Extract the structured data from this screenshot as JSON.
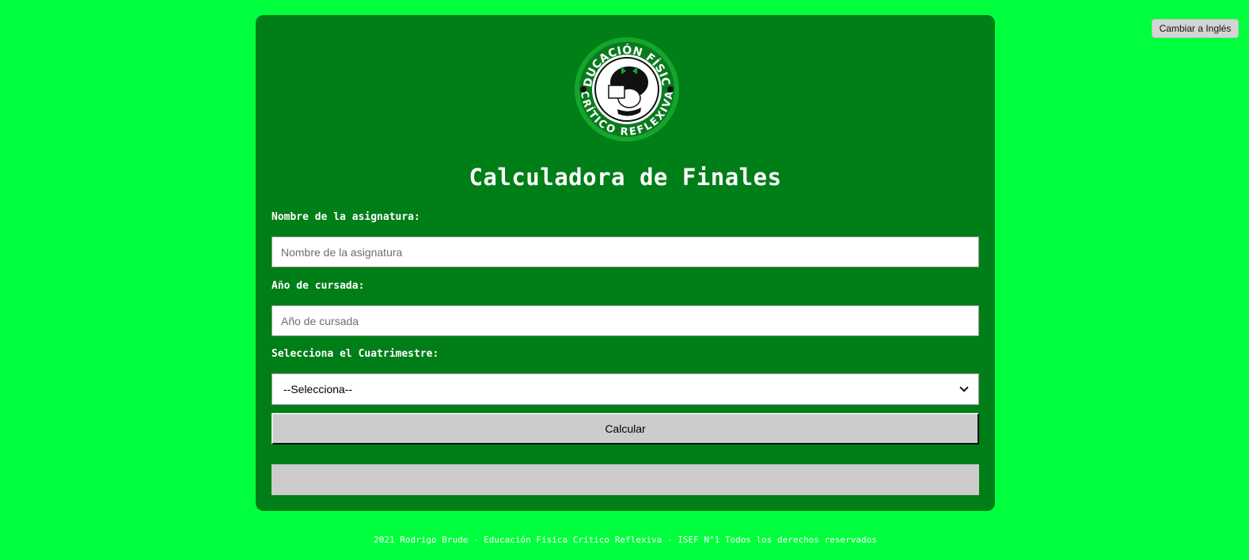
{
  "language_toggle": {
    "label": "Cambiar a Inglés"
  },
  "logo": {
    "top_text": "EDUCACIÓN FÍSICA",
    "bottom_text": "CRÍTICO REFLEXIVA",
    "icon": "mafalda-reading-logo"
  },
  "form": {
    "title": "Calculadora de Finales",
    "subject": {
      "label": "Nombre de la asignatura:",
      "placeholder": "Nombre de la asignatura",
      "value": ""
    },
    "year": {
      "label": "Año de cursada:",
      "placeholder": "Año de cursada",
      "value": ""
    },
    "term": {
      "label": "Selecciona el Cuatrimestre:",
      "selected": "--Selecciona--"
    },
    "calculate_label": "Calcular",
    "result": ""
  },
  "footer": {
    "text": "2021 Rodrigo Brude - Educación Física Crítico Reflexiva - ISEF N°1 Todos los derechos reservados"
  },
  "colors": {
    "page_background": "#00ff3c",
    "card_background": "#007e17",
    "button_gray": "#cccccc"
  }
}
